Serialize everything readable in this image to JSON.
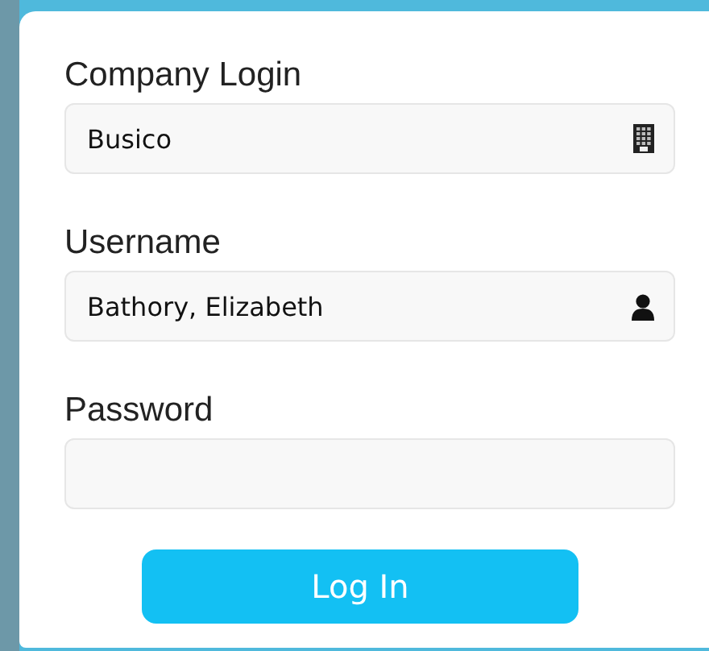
{
  "fields": [
    {
      "label": "Company Login",
      "kind": "company",
      "value": "Busico"
    },
    {
      "label": "Username",
      "kind": "user",
      "value": "Bathory, Elizabeth"
    },
    {
      "label": "Password",
      "kind": "password"
    }
  ],
  "button": {
    "label": "Log In"
  }
}
